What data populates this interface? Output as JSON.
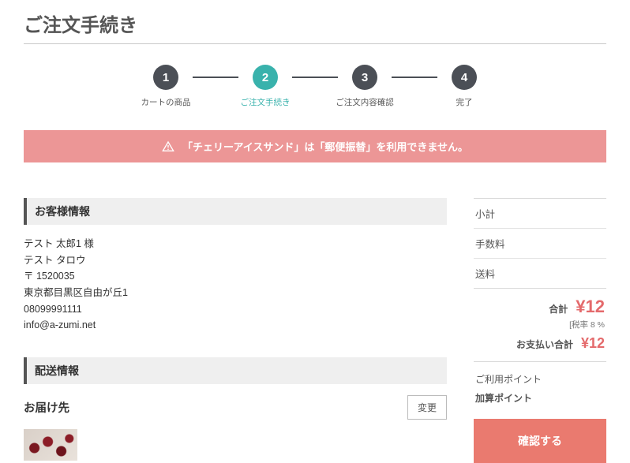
{
  "page_title": "ご注文手続き",
  "steps": [
    {
      "num": "1",
      "label": "カートの商品"
    },
    {
      "num": "2",
      "label": "ご注文手続き"
    },
    {
      "num": "3",
      "label": "ご注文内容確認"
    },
    {
      "num": "4",
      "label": "完了"
    }
  ],
  "alert": "「チェリーアイスサンド」は「郵便振替」を利用できません。",
  "customer": {
    "heading": "お客様情報",
    "name": "テスト 太郎1 様",
    "kana": "テスト タロウ",
    "postal": "〒 1520035",
    "address": "東京都目黒区自由が丘1",
    "tel": "08099991111",
    "email": "info@a-zumi.net"
  },
  "delivery": {
    "heading": "配送情報",
    "sub_heading": "お届け先",
    "change": "変更"
  },
  "summary": {
    "subtotal_label": "小計",
    "fee_label": "手数料",
    "shipping_label": "送料",
    "total_label": "合計",
    "total_value": "¥12",
    "tax_note": "[税率 8 %",
    "pay_label": "お支払い合計",
    "pay_value": "¥12",
    "point_use": "ご利用ポイント",
    "point_add": "加算ポイント",
    "confirm": "確認する"
  }
}
